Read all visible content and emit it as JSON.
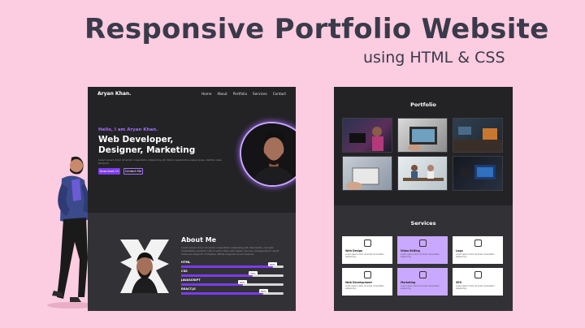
{
  "banner": {
    "title": "Responsive Portfolio Website",
    "subtitle": "using HTML & CSS"
  },
  "site_home": {
    "logo": "Aryan Khan.",
    "nav": [
      "Home",
      "About",
      "Portfolio",
      "Services",
      "Contact"
    ],
    "hero_kicker": "Hello, I am Aryan Khan.",
    "hero_title": "Web Developer, Designer, Marketing",
    "hero_description": "Lorem ipsum dolor sit amet consectetur adipisicing elit. Nemo repellendus eaque quas, debitis culpa tempore",
    "download_cv": "Download CV",
    "contact_me": "Contact Me",
    "about_title": "About Me",
    "about_description": "Lorem ipsum dolor sit amet consectetur adipisicing elit. Reiciendis, corrupti. Voluptatibus quidem odit id nemo alias nam ipsam eius ea consequuntur? Amet dicta eos eligendi, molestias officiis magnam ut accusamus",
    "skills": [
      {
        "name": "HTML",
        "percent": "90%",
        "level": 0.9
      },
      {
        "name": "CSS",
        "percent": "70%",
        "level": 0.7
      },
      {
        "name": "JAVASCRIPT",
        "percent": "60%",
        "level": 0.6
      },
      {
        "name": "REACT.JS",
        "percent": "80%",
        "level": 0.8
      }
    ]
  },
  "site_portfolio": {
    "portfolio_title": "Portfolio",
    "services_title": "Services",
    "services": [
      {
        "title": "Web Design",
        "desc": "Lorem ipsum dolor sit amet consectetur adipisicing",
        "highlighted": false
      },
      {
        "title": "Video Editing",
        "desc": "Lorem ipsum dolor sit amet consectetur adipisicing",
        "highlighted": true
      },
      {
        "title": "Logo",
        "desc": "Lorem ipsum dolor sit amet consectetur adipisicing",
        "highlighted": false
      },
      {
        "title": "Web Development",
        "desc": "Lorem ipsum dolor sit amet consectetur adipisicing",
        "highlighted": false
      },
      {
        "title": "Marketing",
        "desc": "Lorem ipsum dolor sit amet consectetur adipisicing",
        "highlighted": true
      },
      {
        "title": "SEO",
        "desc": "Lorem ipsum dolor sit amet consectetur adipisicing",
        "highlighted": false
      }
    ]
  },
  "colors": {
    "background": "#fccce0",
    "accent": "#7c3aed",
    "dark": "#232326",
    "highlight_card": "#c9a8ff"
  }
}
